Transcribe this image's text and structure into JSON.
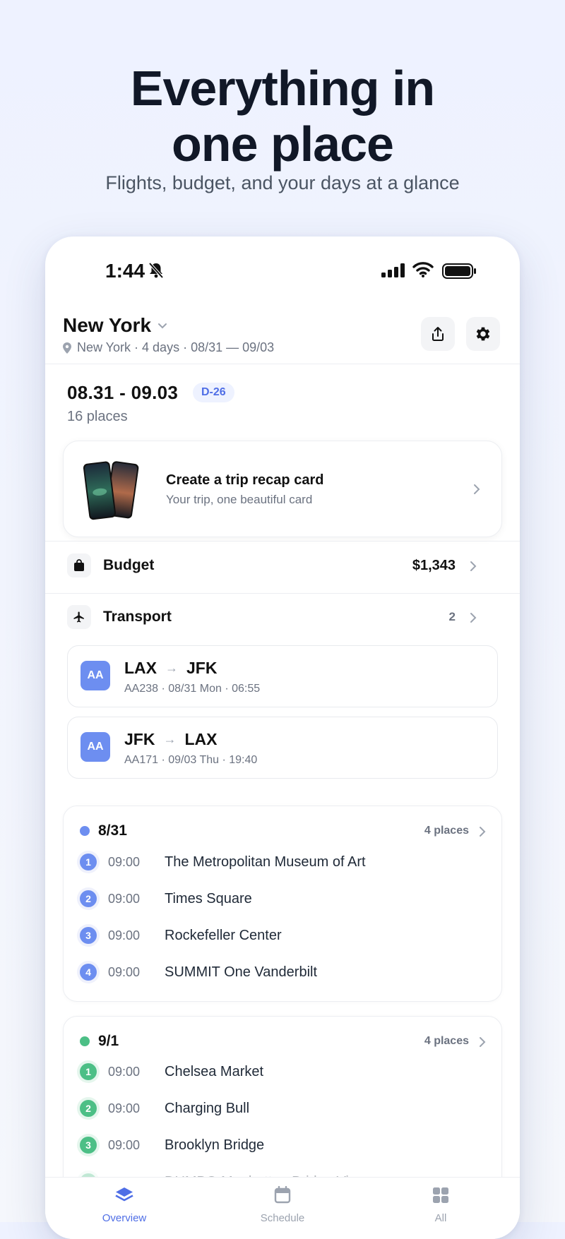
{
  "hero": {
    "title": "Everything in\none place",
    "subtitle": "Flights, budget, and your days at a glance"
  },
  "status_bar": {
    "time": "1:44"
  },
  "trip": {
    "city": "New York",
    "subtitle": "New York · 4 days · 08/31 — 09/03",
    "date_range": "08.31 - 09.03",
    "dday": "D-26",
    "places": "16 places"
  },
  "recap": {
    "title": "Create a trip recap card",
    "subtitle": "Your trip, one beautiful card"
  },
  "budget": {
    "label": "Budget",
    "amount": "$1,343"
  },
  "transport": {
    "label": "Transport",
    "count": "2",
    "flights": [
      {
        "airline": "AA",
        "from": "LAX",
        "to": "JFK",
        "detail": "AA238 · 08/31 Mon · 06:55"
      },
      {
        "airline": "AA",
        "from": "JFK",
        "to": "LAX",
        "detail": "AA171 · 09/03 Thu · 19:40"
      }
    ]
  },
  "days": [
    {
      "label": "8/31",
      "count": "4 places",
      "color": "#6d8ef0",
      "stops": [
        {
          "n": "1",
          "time": "09:00",
          "name": "The Metropolitan Museum of Art"
        },
        {
          "n": "2",
          "time": "09:00",
          "name": "Times Square"
        },
        {
          "n": "3",
          "time": "09:00",
          "name": "Rockefeller Center"
        },
        {
          "n": "4",
          "time": "09:00",
          "name": "SUMMIT One Vanderbilt"
        }
      ]
    },
    {
      "label": "9/1",
      "count": "4 places",
      "color": "#4cbf86",
      "stops": [
        {
          "n": "1",
          "time": "09:00",
          "name": "Chelsea Market"
        },
        {
          "n": "2",
          "time": "09:00",
          "name": "Charging Bull"
        },
        {
          "n": "3",
          "time": "09:00",
          "name": "Brooklyn Bridge"
        },
        {
          "n": "4",
          "time": "",
          "name": "DUMBO Manhattan Bridge View"
        }
      ]
    }
  ],
  "tabs": [
    {
      "label": "Overview",
      "active": true,
      "icon": "layers-icon"
    },
    {
      "label": "Schedule",
      "active": false,
      "icon": "calendar-icon"
    },
    {
      "label": "All",
      "active": false,
      "icon": "grid-icon"
    }
  ],
  "colors": {
    "accent": "#4f6ee6",
    "day1": "#6d8ef0",
    "day2": "#4cbf86"
  }
}
